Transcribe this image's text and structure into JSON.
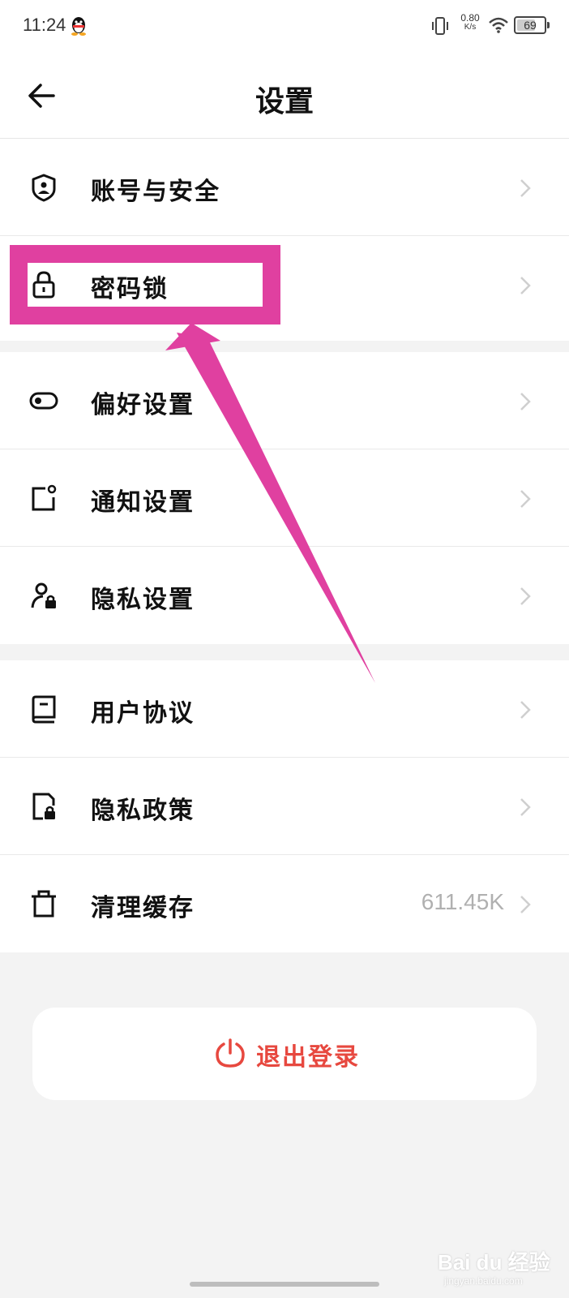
{
  "status_bar": {
    "time": "11:24",
    "net_speed_value": "0.80",
    "net_speed_unit": "K/s",
    "battery": "69",
    "battery_level": 0.69
  },
  "header": {
    "title": "设置"
  },
  "groups": [
    {
      "items": [
        {
          "label": "账号与安全",
          "icon": "shield-user-icon"
        },
        {
          "label": "密码锁",
          "icon": "lock-icon"
        }
      ]
    },
    {
      "items": [
        {
          "label": "偏好设置",
          "icon": "toggle-icon"
        },
        {
          "label": "通知设置",
          "icon": "notification-icon"
        },
        {
          "label": "隐私设置",
          "icon": "user-lock-icon"
        }
      ]
    },
    {
      "items": [
        {
          "label": "用户协议",
          "icon": "book-icon"
        },
        {
          "label": "隐私政策",
          "icon": "doc-lock-icon"
        },
        {
          "label": "清理缓存",
          "icon": "trash-icon",
          "value": "611.45K"
        }
      ]
    }
  ],
  "logout": {
    "label": "退出登录",
    "icon": "power-icon"
  },
  "colors": {
    "accent_red": "#e7483f",
    "highlight_magenta": "#e040a0"
  },
  "watermark": {
    "text": "Bai du 经验",
    "sub": "jingyan.baidu.com"
  }
}
